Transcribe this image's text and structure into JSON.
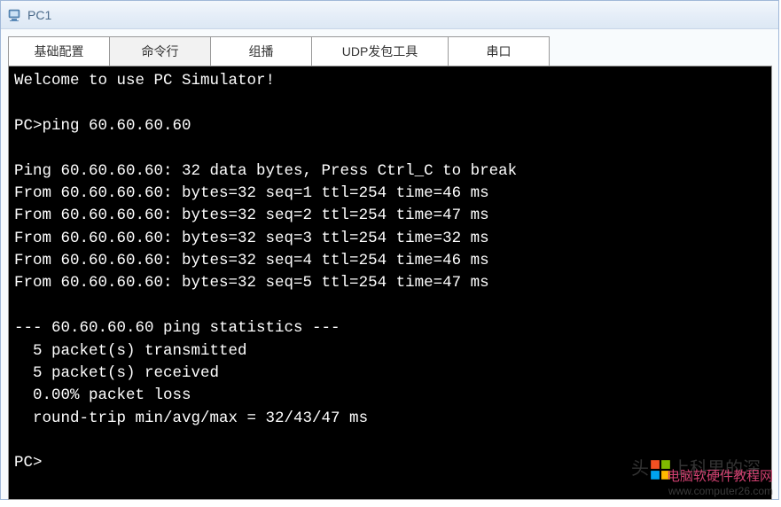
{
  "window": {
    "title": "PC1"
  },
  "tabs": {
    "items": [
      {
        "label": "基础配置",
        "active": false
      },
      {
        "label": "命令行",
        "active": true
      },
      {
        "label": "组播",
        "active": false
      },
      {
        "label": "UDP发包工具",
        "active": false
      },
      {
        "label": "串口",
        "active": false
      }
    ]
  },
  "terminal": {
    "welcome": "Welcome to use PC Simulator!",
    "prompt1": "PC>ping 60.60.60.60",
    "ping_header": "Ping 60.60.60.60: 32 data bytes, Press Ctrl_C to break",
    "replies": [
      "From 60.60.60.60: bytes=32 seq=1 ttl=254 time=46 ms",
      "From 60.60.60.60: bytes=32 seq=2 ttl=254 time=47 ms",
      "From 60.60.60.60: bytes=32 seq=3 ttl=254 time=32 ms",
      "From 60.60.60.60: bytes=32 seq=4 ttl=254 time=46 ms",
      "From 60.60.60.60: bytes=32 seq=5 ttl=254 time=47 ms"
    ],
    "stats_header": "--- 60.60.60.60 ping statistics ---",
    "stats": [
      "  5 packet(s) transmitted",
      "  5 packet(s) received",
      "  0.00% packet loss",
      "  round-trip min/avg/max = 32/43/47 ms"
    ],
    "prompt2": "PC>"
  },
  "watermark": {
    "text1_prefix": "头",
    "text1_suffix": "上科男的深",
    "text2_line1": "电脑软硬件教程网",
    "text2_line2": "www.computer26.com"
  }
}
